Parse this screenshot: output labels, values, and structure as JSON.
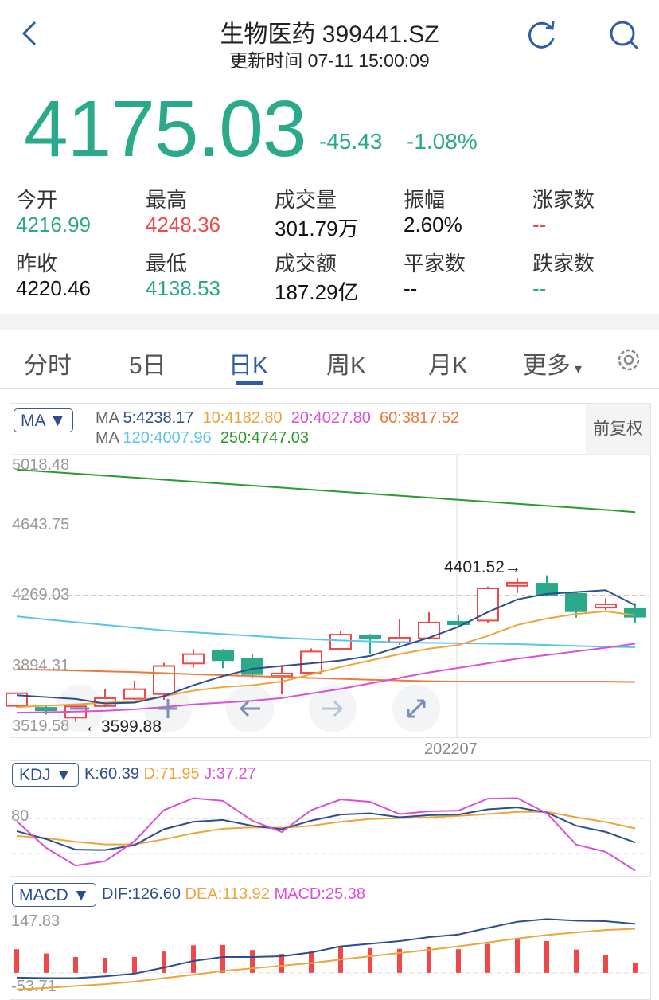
{
  "header": {
    "title": "生物医药 399441.SZ",
    "subtitle": "更新时间 07-11 15:00:09",
    "icons": [
      "chevron-left-icon",
      "refresh-icon",
      "search-icon"
    ]
  },
  "quote": {
    "price": "4175.03",
    "change": "-45.43",
    "change_pct": "-1.08%"
  },
  "stats": [
    {
      "label": "今开",
      "value": "4216.99",
      "color": "#2aa98b"
    },
    {
      "label": "最高",
      "value": "4248.36",
      "color": "#f04848"
    },
    {
      "label": "成交量",
      "value": "301.79万",
      "color": "#111111"
    },
    {
      "label": "振幅",
      "value": "2.60%",
      "color": "#111111"
    },
    {
      "label": "涨家数",
      "value": "--",
      "color": "#f04848"
    },
    {
      "label": "昨收",
      "value": "4220.46",
      "color": "#111111"
    },
    {
      "label": "最低",
      "value": "4138.53",
      "color": "#2aa98b"
    },
    {
      "label": "成交额",
      "value": "187.29亿",
      "color": "#111111"
    },
    {
      "label": "平家数",
      "value": "--",
      "color": "#111111"
    },
    {
      "label": "跌家数",
      "value": "--",
      "color": "#2aa98b"
    }
  ],
  "tabs": [
    {
      "label": "分时"
    },
    {
      "label": "5日"
    },
    {
      "label": "日K",
      "selected": true
    },
    {
      "label": "周K"
    },
    {
      "label": "月K"
    },
    {
      "label": "更多"
    }
  ],
  "colors": {
    "up": "#f04848",
    "down": "#2aa98b",
    "accent": "#2b5ea8",
    "ma5": "#2b4f8c",
    "ma10": "#eba53a",
    "ma20": "#d94fd9",
    "ma60": "#ec7a3c",
    "ma120": "#5bc4ea",
    "ma250": "#2a9a2a"
  },
  "main_chart": {
    "indicator": "MA ▼",
    "adjust": "前复权",
    "legend_row1": {
      "prefix": "MA ",
      "ma5": "5:4238.17",
      "ma10": "10:4182.80",
      "ma20": "20:4027.80",
      "ma60": "60:3817.52"
    },
    "legend_row2": {
      "prefix": "MA ",
      "ma120": "120:4007.96",
      "ma250": "250:4747.03"
    },
    "y_labels": [
      "5018.48",
      "4643.75",
      "4269.03",
      "3894.31",
      "3519.58"
    ],
    "last_close_line": "4269.03",
    "x_label": "202207",
    "high_label": "4401.52→",
    "low_label": "←3599.88",
    "controls": [
      "zoom-out",
      "zoom-in",
      "pan-left",
      "pan-right",
      "fullscreen"
    ]
  },
  "kdj": {
    "indicator": "KDJ ▼",
    "k_label": "K:60.39",
    "d_label": "D:71.95",
    "j_label": "J:37.27",
    "y_label": "80"
  },
  "macd": {
    "indicator": "MACD ▼",
    "dif_label": "DIF:126.60",
    "dea_label": "DEA:113.92",
    "macd_label": "MACD:25.38",
    "y_top": "147.83",
    "y_bottom": "-53.71"
  },
  "chart_data": [
    {
      "type": "candlestick",
      "ylim": [
        3519.58,
        5018.48
      ],
      "x_tick": "202207",
      "ohlc": [
        [
          3687,
          3760,
          3680,
          3756
        ],
        [
          3676,
          3687,
          3640,
          3665
        ],
        [
          3623,
          3690,
          3599.88,
          3684
        ],
        [
          3686,
          3777,
          3680,
          3729
        ],
        [
          3726,
          3825,
          3720,
          3778
        ],
        [
          3752,
          3922,
          3720,
          3905
        ],
        [
          3919,
          3997,
          3897,
          3970
        ],
        [
          3986,
          3997,
          3893,
          3937
        ],
        [
          3944,
          3970,
          3840,
          3861
        ],
        [
          3850,
          3905,
          3750,
          3864
        ],
        [
          3868,
          4001,
          3860,
          3984
        ],
        [
          3999,
          4098,
          3995,
          4077
        ],
        [
          4073,
          4080,
          3970,
          4055
        ],
        [
          4035,
          4164,
          4020,
          4060
        ],
        [
          4057,
          4199,
          4050,
          4143
        ],
        [
          4147,
          4186,
          4115,
          4137
        ],
        [
          4154,
          4340,
          4140,
          4330
        ],
        [
          4344,
          4385,
          4305,
          4361
        ],
        [
          4356,
          4401.52,
          4285,
          4292
        ],
        [
          4300,
          4310,
          4170,
          4205
        ],
        [
          4225,
          4275,
          4210,
          4243
        ],
        [
          4216.99,
          4248.36,
          4138.53,
          4175.03
        ]
      ],
      "ma5": [
        3745,
        3735,
        3725,
        3700,
        3705,
        3740,
        3800,
        3850,
        3890,
        3905,
        3920,
        3935,
        3960,
        4010,
        4060,
        4120,
        4200,
        4270,
        4300,
        4310,
        4320,
        4238.17
      ],
      "ma10": [
        3680,
        3688,
        3695,
        3705,
        3712,
        3740,
        3770,
        3790,
        3800,
        3820,
        3860,
        3900,
        3935,
        3970,
        4000,
        4020,
        4070,
        4130,
        4165,
        4190,
        4205,
        4182.8
      ],
      "ma20": [
        3650,
        3652,
        3656,
        3660,
        3668,
        3680,
        3695,
        3705,
        3715,
        3730,
        3755,
        3780,
        3810,
        3840,
        3870,
        3895,
        3920,
        3945,
        3965,
        3985,
        4005,
        4027.8
      ],
      "ma60": [
        3887,
        3884,
        3880,
        3876,
        3872,
        3866,
        3860,
        3855,
        3850,
        3845,
        3840,
        3835,
        3830,
        3826,
        3822,
        3820,
        3820,
        3820,
        3820,
        3820,
        3820,
        3817.52
      ],
      "ma120": [
        4177,
        4160,
        4145,
        4130,
        4115,
        4100,
        4090,
        4080,
        4070,
        4060,
        4052,
        4045,
        4040,
        4035,
        4032,
        4030,
        4028,
        4025,
        4020,
        4015,
        4010,
        4007.96
      ],
      "ma250": [
        4980,
        4969,
        4958,
        4947,
        4936,
        4925,
        4914,
        4903,
        4892,
        4881,
        4870,
        4859,
        4848,
        4837,
        4826,
        4815,
        4804,
        4793,
        4782,
        4771,
        4760,
        4747.03
      ]
    },
    {
      "type": "line",
      "name": "KDJ",
      "ylim": [
        35,
        103
      ],
      "K": [
        69.7,
        63.2,
        54.5,
        54.2,
        58.2,
        71.3,
        77.4,
        78.9,
        74.1,
        71.3,
        78.3,
        83.3,
        84.4,
        81.1,
        82.8,
        83.3,
        87.6,
        89.2,
        85,
        74.1,
        69.1,
        60.39
      ],
      "D": [
        65.8,
        64,
        61,
        58.8,
        58.8,
        63,
        68,
        71.7,
        72.8,
        72.4,
        74.1,
        77.4,
        79.6,
        80.4,
        81,
        82.2,
        83.7,
        85.5,
        85.5,
        81.1,
        77.2,
        71.95
      ],
      "J": [
        77.8,
        56,
        41.4,
        45,
        61.4,
        87,
        96.8,
        94.6,
        78.3,
        69,
        87,
        95.7,
        93.8,
        83.7,
        86,
        86.6,
        96.4,
        96.8,
        84.4,
        58.6,
        52.7,
        37.27
      ]
    },
    {
      "type": "bar",
      "name": "MACD",
      "ylim": [
        -53.71,
        147.83
      ],
      "DIF": [
        -12.3,
        -13.7,
        -13.7,
        -8.9,
        -2,
        13.7,
        30.7,
        41,
        41,
        43,
        52.6,
        68.3,
        75.1,
        82,
        92.2,
        99,
        116,
        132,
        138.9,
        134.8,
        133.4,
        126.6
      ],
      "DEA": [
        -43,
        -39,
        -34,
        -29.4,
        -22.5,
        -13.7,
        -4.8,
        4.8,
        11.6,
        18.4,
        25.3,
        34.2,
        43,
        51.2,
        59.4,
        68.3,
        78.5,
        88.8,
        97.7,
        104.5,
        110.6,
        113.92
      ],
      "MACD": [
        61,
        50,
        41,
        39,
        41,
        55,
        71,
        72,
        59,
        49,
        55,
        68,
        64,
        62,
        66,
        61,
        75,
        86,
        82,
        60,
        45,
        25.38
      ]
    }
  ]
}
